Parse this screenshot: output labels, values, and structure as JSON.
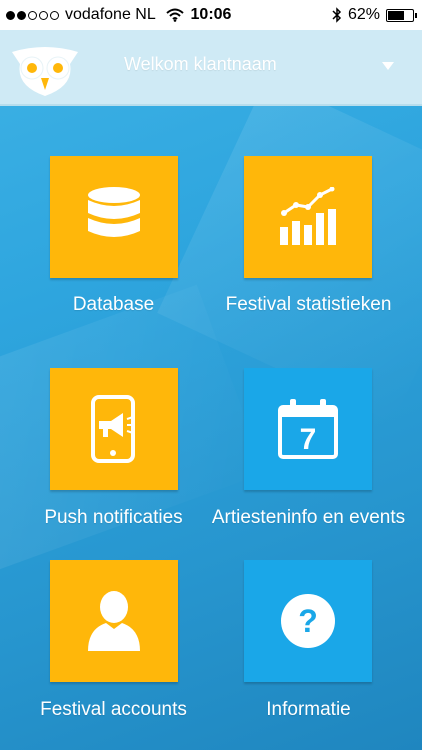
{
  "status_bar": {
    "carrier": "vodafone NL",
    "time": "10:06",
    "battery_percent": "62%",
    "battery_level": 0.62,
    "signal_dots_filled": 2,
    "signal_dots_total": 5
  },
  "header": {
    "welcome": "Welkom klantnaam"
  },
  "tiles": [
    {
      "label": "Database",
      "icon": "database-icon",
      "color": "#ffb70a"
    },
    {
      "label": "Festival statistieken",
      "icon": "bar-chart-icon",
      "color": "#ffb70a"
    },
    {
      "label": "Push notificaties",
      "icon": "phone-megaphone-icon",
      "color": "#ffb70a"
    },
    {
      "label": "Artiesteninfo en events",
      "icon": "calendar-icon",
      "color": "#1aa7e8",
      "calendar_day": "7"
    },
    {
      "label": "Festival accounts",
      "icon": "user-icon",
      "color": "#ffb70a"
    },
    {
      "label": "Informatie",
      "icon": "question-icon",
      "color": "#1aa7e8",
      "question_mark": "?"
    }
  ],
  "colors": {
    "background": "#2ea5de",
    "header": "#cfeaf5",
    "yellow_tile": "#ffb70a",
    "blue_tile": "#1aa7e8"
  }
}
